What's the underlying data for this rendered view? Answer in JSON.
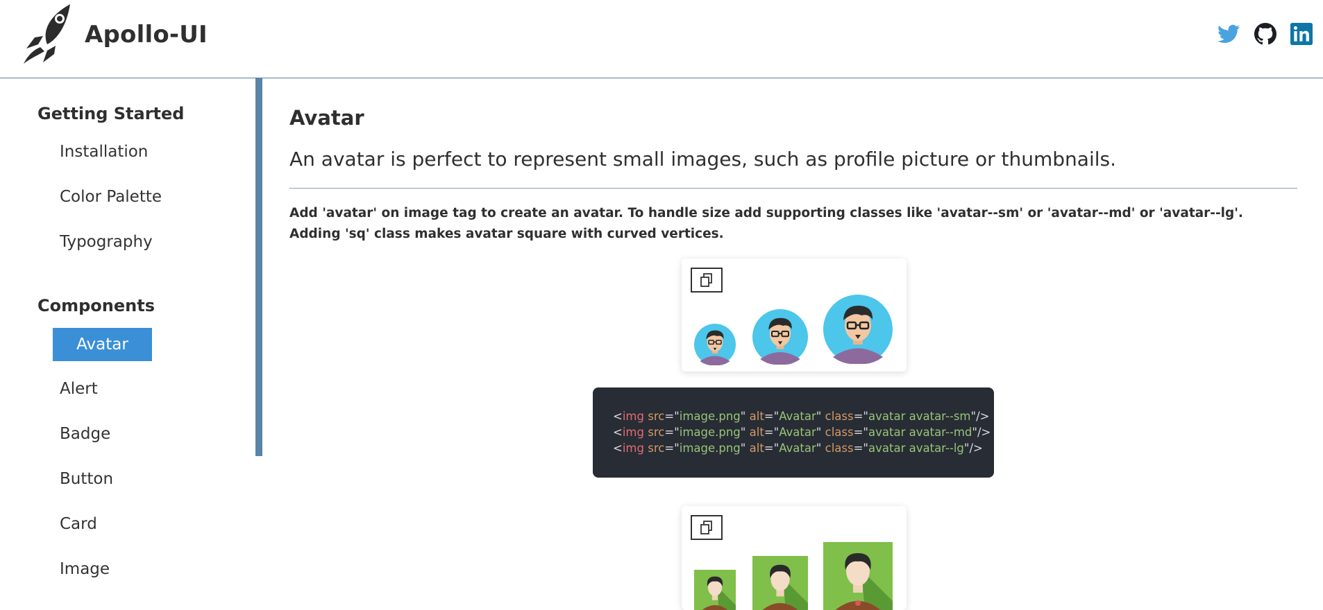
{
  "header": {
    "brand": "Apollo-UI",
    "logo_icon": "rocket-icon",
    "social": [
      {
        "name": "twitter",
        "icon": "twitter-icon",
        "color": "#4aa3df"
      },
      {
        "name": "github",
        "icon": "github-icon",
        "color": "#1b1f23"
      },
      {
        "name": "linkedin",
        "icon": "linkedin-icon",
        "color": "#0e76a8"
      }
    ]
  },
  "sidebar": {
    "sections": [
      {
        "title": "Getting Started",
        "items": [
          "Installation",
          "Color Palette",
          "Typography"
        ]
      },
      {
        "title": "Components",
        "items": [
          "Avatar",
          "Alert",
          "Badge",
          "Button",
          "Card",
          "Image"
        ]
      }
    ],
    "active_item": "Avatar",
    "accent_color": "#3b8fd6"
  },
  "main": {
    "title": "Avatar",
    "subtitle": "An avatar is perfect to represent small images, such as profile picture or thumbnails.",
    "description": "Add 'avatar' on image tag to create an avatar. To handle size add supporting classes like 'avatar--sm' or 'avatar--md' or 'avatar--lg'. Adding 'sq' class makes avatar square with curved vertices.",
    "code_lines": [
      {
        "tag": "img",
        "src": "image.png",
        "alt": "Avatar",
        "class": "avatar avatar--sm"
      },
      {
        "tag": "img",
        "src": "image.png",
        "alt": "Avatar",
        "class": "avatar avatar--md"
      },
      {
        "tag": "img",
        "src": "image.png",
        "alt": "Avatar",
        "class": "avatar avatar--lg"
      }
    ],
    "copy_icon": "copy-icon"
  }
}
